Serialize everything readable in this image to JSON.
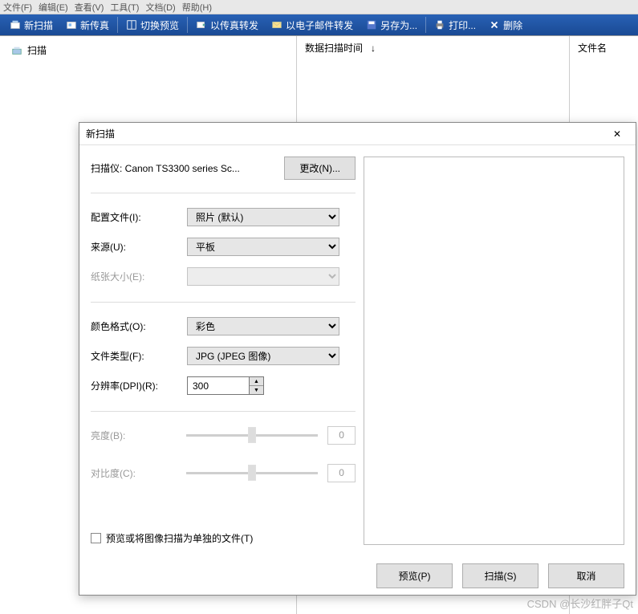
{
  "menubar": [
    "文件(F)",
    "编辑(E)",
    "查看(V)",
    "工具(T)",
    "文档(D)",
    "帮助(H)"
  ],
  "toolbar": {
    "new_scan": "新扫描",
    "new_fax": "新传真",
    "toggle_preview": "切换预览",
    "fax_forward": "以传真转发",
    "email_forward": "以电子邮件转发",
    "save_as": "另存为...",
    "print": "打印...",
    "delete": "删除"
  },
  "tree": {
    "scan_root": "扫描"
  },
  "columns": {
    "scan_time": "数据扫描时间",
    "time_sep": "↓",
    "filename": "文件名"
  },
  "dialog": {
    "title": "新扫描",
    "scanner_label": "扫描仪: Canon TS3300 series Sc...",
    "change_btn": "更改(N)...",
    "profile_label": "配置文件(I):",
    "profile_value": "照片 (默认)",
    "source_label": "来源(U):",
    "source_value": "平板",
    "paper_label": "纸张大小(E):",
    "color_label": "颜色格式(O):",
    "color_value": "彩色",
    "filetype_label": "文件类型(F):",
    "filetype_value": "JPG (JPEG 图像)",
    "dpi_label": "分辨率(DPI)(R):",
    "dpi_value": "300",
    "brightness_label": "亮度(B):",
    "brightness_value": "0",
    "contrast_label": "对比度(C):",
    "contrast_value": "0",
    "checkbox_label": "预览或将图像扫描为单独的文件(T)",
    "preview_btn": "预览(P)",
    "scan_btn": "扫描(S)",
    "cancel_btn": "取消"
  },
  "watermark": "CSDN @长沙红胖子Qt"
}
